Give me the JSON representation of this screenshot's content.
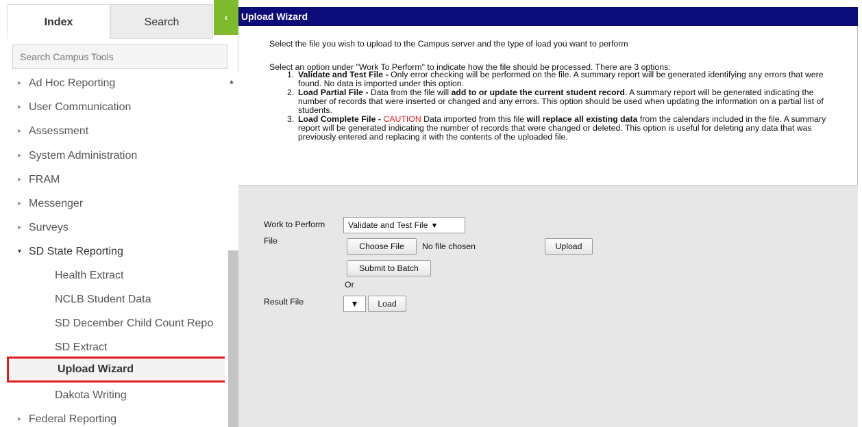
{
  "sidebar": {
    "tabs": {
      "index": "Index",
      "search": "Search",
      "collapse": "‹"
    },
    "search_placeholder": "Search Campus Tools",
    "items": [
      {
        "label": "Ad Hoc Reporting",
        "arrow": "▸"
      },
      {
        "label": "User Communication",
        "arrow": "▸"
      },
      {
        "label": "Assessment",
        "arrow": "▸"
      },
      {
        "label": "System Administration",
        "arrow": "▸"
      },
      {
        "label": "FRAM",
        "arrow": "▸"
      },
      {
        "label": "Messenger",
        "arrow": "▸"
      },
      {
        "label": "Surveys",
        "arrow": "▸"
      },
      {
        "label": "SD State Reporting",
        "arrow": "▾"
      },
      {
        "label": "Health Extract"
      },
      {
        "label": "NCLB Student Data"
      },
      {
        "label": "SD December Child Count Repo"
      },
      {
        "label": "SD Extract"
      },
      {
        "label": "Upload Wizard"
      },
      {
        "label": "Dakota Writing"
      },
      {
        "label": "Federal Reporting",
        "arrow": "▸"
      }
    ],
    "scroll_up": "▲"
  },
  "main": {
    "title": "Upload Wizard",
    "intro": "Select the file you wish to upload to the Campus server and the type of load you want to perform",
    "options_intro": "Select an option under \"Work To Perform\" to indicate how the file should be processed. There are 3 options:",
    "options": [
      {
        "num": "1.",
        "title": "Validate and Test File - ",
        "text": "Only error checking will be performed on the file. A summary report will be generated identifying any errors that were found. No data is imported under this option."
      },
      {
        "num": "2.",
        "title": "Load Partial File - ",
        "text_a": "Data from the file will ",
        "bold_a": "add to or update the current student record",
        "text_b": ". A summary report will be generated indicating the number of records that were inserted or changed and any errors. This option should be used when updating the information on a partial list of students."
      },
      {
        "num": "3.",
        "title": "Load Complete File - ",
        "caution": "CAUTION",
        "text_a": " Data imported from this file ",
        "bold_a": "will replace all existing data",
        "text_b": " from the calendars included in the file. A summary report will be generated indicating the number of records that were changed or deleted. This option is useful for deleting any data that was previously entered and replacing it with the contents of the uploaded file."
      }
    ],
    "form": {
      "work_label": "Work to Perform",
      "work_value": "Validate and Test File",
      "caret": "▼",
      "file_label": "File",
      "choose_file": "Choose File",
      "no_file": "No file chosen",
      "upload": "Upload",
      "submit_batch": "Submit to Batch",
      "or": "Or",
      "result_label": "Result File",
      "load": "Load"
    }
  },
  "colors": {
    "header_bg": "#0b0b7a",
    "collapse_green": "#7dbb2c",
    "highlight_border": "#e31b1b",
    "caution": "#e31b1b"
  }
}
